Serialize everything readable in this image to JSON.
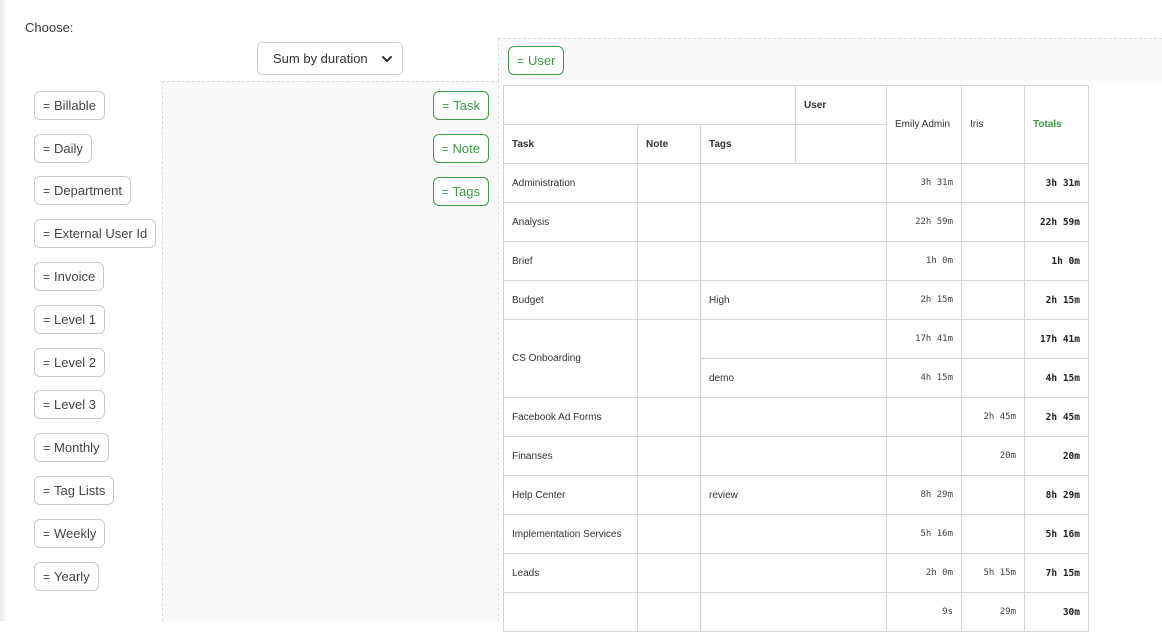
{
  "choose_label": "Choose:",
  "aggregator": {
    "selected": "Sum by duration",
    "icon": "chevron-down-icon"
  },
  "unused_fields": [
    {
      "label": "Billable"
    },
    {
      "label": "Daily"
    },
    {
      "label": "Department"
    },
    {
      "label": "External User Id"
    },
    {
      "label": "Invoice"
    },
    {
      "label": "Level 1"
    },
    {
      "label": "Level 2"
    },
    {
      "label": "Level 3"
    },
    {
      "label": "Monthly"
    },
    {
      "label": "Tag Lists"
    },
    {
      "label": "Weekly"
    },
    {
      "label": "Yearly"
    }
  ],
  "column_fields": [
    {
      "label": "User"
    }
  ],
  "row_fields": [
    {
      "label": "Task"
    },
    {
      "label": "Note"
    },
    {
      "label": "Tags"
    }
  ],
  "grip_glyph": "=",
  "table": {
    "col_attr_header": "User",
    "row_headers": [
      "Task",
      "Note",
      "Tags"
    ],
    "columns": [
      "Emily Admin",
      "Iris"
    ],
    "totals_header": "Totals",
    "rows": [
      {
        "task": "Administration",
        "note": "",
        "tags": "",
        "emily": "3h 31m",
        "iris": "",
        "total": "3h 31m"
      },
      {
        "task": "Analysis",
        "note": "",
        "tags": "",
        "emily": "22h 59m",
        "iris": "",
        "total": "22h 59m"
      },
      {
        "task": "Brief",
        "note": "",
        "tags": "",
        "emily": "1h 0m",
        "iris": "",
        "total": "1h 0m"
      },
      {
        "task": "Budget",
        "note": "",
        "tags": "High",
        "emily": "2h 15m",
        "iris": "",
        "total": "2h 15m"
      },
      {
        "task": "CS Onboarding",
        "note": "",
        "tags": "",
        "emily": "17h 41m",
        "iris": "",
        "total": "17h 41m"
      },
      {
        "task": "",
        "note": "",
        "tags": "demo",
        "emily": "4h 15m",
        "iris": "",
        "total": "4h 15m"
      },
      {
        "task": "Facebook Ad Forms",
        "note": "",
        "tags": "",
        "emily": "",
        "iris": "2h 45m",
        "total": "2h 45m"
      },
      {
        "task": "Finanses",
        "note": "",
        "tags": "",
        "emily": "",
        "iris": "20m",
        "total": "20m"
      },
      {
        "task": "Help Center",
        "note": "",
        "tags": "review",
        "emily": "8h 29m",
        "iris": "",
        "total": "8h 29m"
      },
      {
        "task": "Implementation Services",
        "note": "",
        "tags": "",
        "emily": "5h 16m",
        "iris": "",
        "total": "5h 16m"
      },
      {
        "task": "Leads",
        "note": "",
        "tags": "",
        "emily": "2h 0m",
        "iris": "5h 15m",
        "total": "7h 15m"
      },
      {
        "task": "",
        "note": "",
        "tags": "",
        "emily": "9s",
        "iris": "29m",
        "total": "30m"
      }
    ]
  }
}
